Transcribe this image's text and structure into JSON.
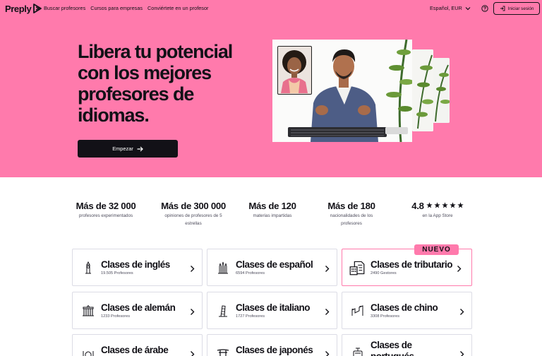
{
  "nav": {
    "brand": "Preply",
    "links": [
      "Buscar profesores",
      "Cursos para empresas",
      "Conviértete en un profesor"
    ],
    "language_currency": "Español, EUR",
    "login_label": "Iniciar sesión"
  },
  "hero": {
    "title": "Libera tu potencial con los mejores profesores de idiomas.",
    "cta_label": "Empezar"
  },
  "stats": [
    {
      "value": "Más de 32 000",
      "label": "profesores experimentados"
    },
    {
      "value": "Más de 300 000",
      "label": "opiniones de profesores de 5 estrellas"
    },
    {
      "value": "Más de 120",
      "label": "materias impartidas"
    },
    {
      "value": "Más de 180",
      "label": "nacionalidades de los profesores"
    },
    {
      "value": "4.8",
      "label": "en la App Store",
      "stars": 5
    }
  ],
  "courses": [
    {
      "title": "Clases de inglés",
      "subtitle": "19.505 Profesores",
      "icon": "big-ben-icon"
    },
    {
      "title": "Clases de español",
      "subtitle": "6594 Profesores",
      "icon": "sagrada-familia-icon"
    },
    {
      "title": "Clases de tributario",
      "subtitle": "2490 Gestores",
      "icon": "tax-document-icon",
      "badge": "NUEVO"
    },
    {
      "title": "Clases de alemán",
      "subtitle": "1233 Profesores",
      "icon": "brandenburg-gate-icon"
    },
    {
      "title": "Clases de italiano",
      "subtitle": "1727 Profesores",
      "icon": "pisa-tower-icon"
    },
    {
      "title": "Clases de chino",
      "subtitle": "3308 Profesores",
      "icon": "great-wall-icon"
    },
    {
      "title": "Clases de árabe",
      "subtitle": "",
      "icon": "mosque-icon"
    },
    {
      "title": "Clases de japonés",
      "subtitle": "",
      "icon": "torii-gate-icon"
    },
    {
      "title": "Clases de portugués",
      "subtitle": "",
      "icon": "tram-icon"
    }
  ],
  "colors": {
    "brand_pink": "#ff7aac",
    "ink": "#121117",
    "border": "#dcdce5"
  }
}
